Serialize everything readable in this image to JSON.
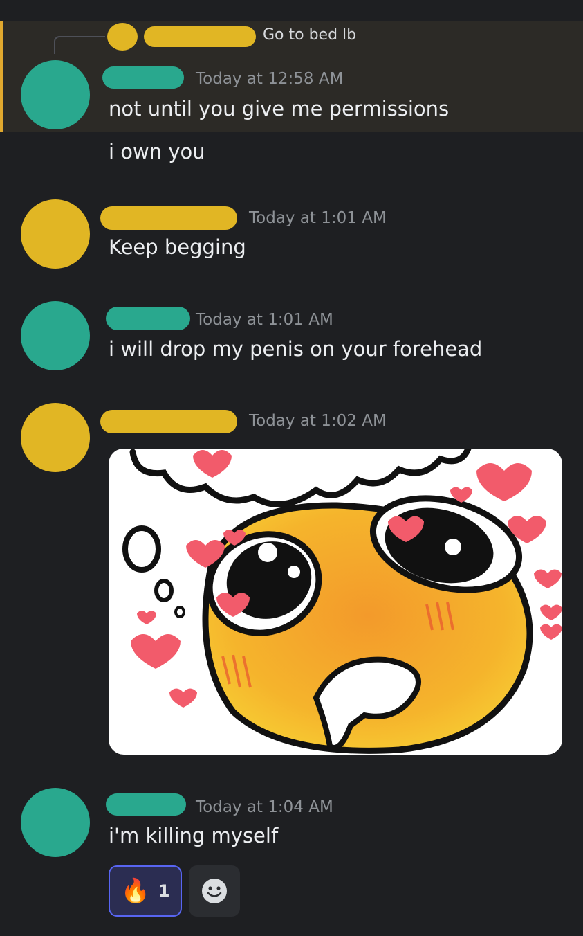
{
  "reply": {
    "text": "Go to bed lb"
  },
  "messages": [
    {
      "timestamp": "Today at 12:58 AM",
      "lines": [
        "not until you give me permissions",
        "i own you"
      ]
    },
    {
      "timestamp": "Today at 1:01 AM",
      "text": "Keep begging"
    },
    {
      "timestamp": "Today at 1:01 AM",
      "text": "i will drop my penis on your forehead"
    },
    {
      "timestamp": "Today at 1:02 AM",
      "attachment_icon": "pleading-face-hearts-meme"
    },
    {
      "timestamp": "Today at 1:04 AM",
      "text": "i'm killing myself"
    }
  ],
  "reactions": [
    {
      "emoji": "fire",
      "glyph": "🔥",
      "count": "1"
    }
  ],
  "add_reaction_icon": "smiley-add-reaction-icon",
  "colors": {
    "background": "#1e1f22",
    "reply_highlight": "#2c2a26",
    "reply_bar": "#e0a82e",
    "avatar_teal": "#29a88e",
    "avatar_gold": "#e1b624",
    "reaction_border": "#5865f2"
  }
}
